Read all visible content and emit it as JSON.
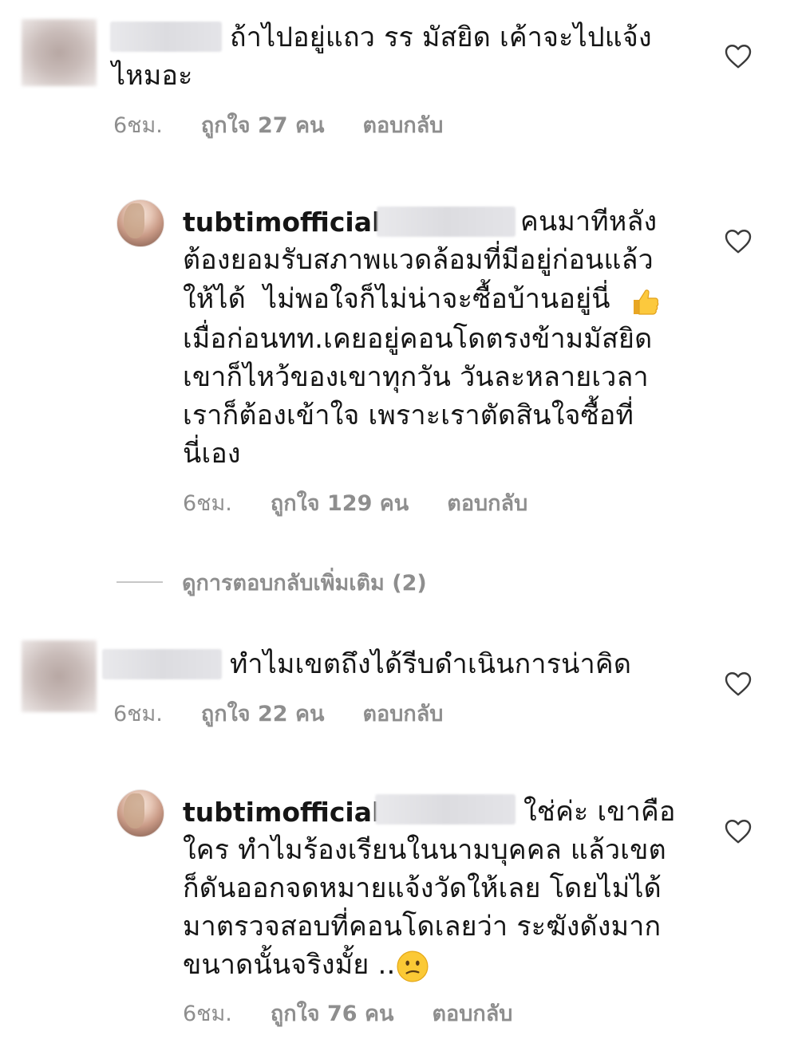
{
  "comments": [
    {
      "name_redacted": true,
      "text_lines": [
        "ถ้าไปอยู่แถว รร มัสยิด เค้าจะไปแจ้ง",
        "ไหมอะ"
      ],
      "time": "6ชม.",
      "likes": "ถูกใจ 27 คน",
      "reply_label": "ตอบกลับ",
      "like_icon": "heart-outline-icon"
    },
    {
      "username": "tubtimofficial",
      "mention_redacted": true,
      "text_lines": [
        "คนมาทีหลัง",
        "ต้องยอมรับสภาพแวดล้อมที่มีอยู่ก่อนแล้ว",
        "ให้ได้  ไม่พอใจก็ไม่น่าจะซื้อบ้านอยู่นี่",
        "เมื่อก่อนทท.เคยอยู่คอนโดตรงข้ามมัสยิด",
        "เขาก็ไหว้ของเขาทุกวัน วันละหลายเวลา",
        "เราก็ต้องเข้าใจ เพราะเราตัดสินใจซื้อที่",
        "นี่เอง"
      ],
      "emoji_icon": "thumbs-up-emoji",
      "time": "6ชม.",
      "likes": "ถูกใจ 129 คน",
      "reply_label": "ตอบกลับ",
      "like_icon": "heart-outline-icon"
    },
    {
      "name_redacted": true,
      "text_lines": [
        "ทำไมเขตถึงได้รีบดำเนินการน่าคิด"
      ],
      "time": "6ชม.",
      "likes": "ถูกใจ 22 คน",
      "reply_label": "ตอบกลับ",
      "like_icon": "heart-outline-icon"
    },
    {
      "username": "tubtimofficial",
      "mention_redacted": true,
      "text_lines": [
        "ใช่ค่ะ เขาคือ",
        "ใคร ทำไมร้องเรียนในนามบุคคล แล้วเขต",
        "ก็ดันออกจดหมายแจ้งวัดให้เลย โดยไม่ได้",
        "มาตรวจสอบที่คอนโดเลยว่า ระฆังดังมาก",
        "ขนาดนั้นจริงมั้ย .."
      ],
      "emoji_icon": "confused-face-emoji",
      "time": "6ชม.",
      "likes": "ถูกใจ 76 คน",
      "reply_label": "ตอบกลับ",
      "like_icon": "heart-outline-icon"
    }
  ],
  "view_more_replies": "ดูการตอบกลับเพิ่มเติม (2)"
}
